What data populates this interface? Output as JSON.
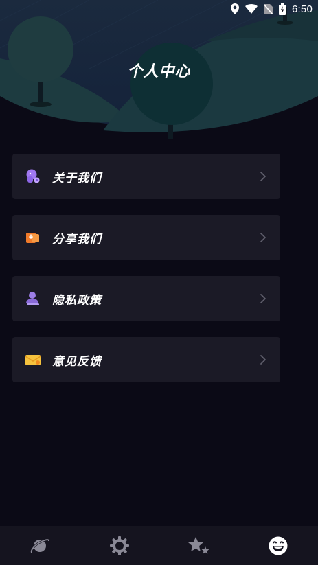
{
  "status_bar": {
    "time": "6:50",
    "icons": [
      "location-icon",
      "wifi-icon",
      "no-sim-icon",
      "battery-charging-icon"
    ]
  },
  "header": {
    "title": "个人中心"
  },
  "menu": [
    {
      "label": "关于我们",
      "icon": "about-us-icon",
      "color": "#a078f0"
    },
    {
      "label": "分享我们",
      "icon": "share-icon",
      "color": "#f07a2a"
    },
    {
      "label": "隐私政策",
      "icon": "privacy-icon",
      "color": "#9c7ee6"
    },
    {
      "label": "意见反馈",
      "icon": "feedback-icon",
      "color": "#f5c23e"
    }
  ],
  "bottom_nav": [
    {
      "icon": "planet-icon",
      "active": false
    },
    {
      "icon": "settings-icon",
      "active": false
    },
    {
      "icon": "stars-icon",
      "active": false
    },
    {
      "icon": "smile-icon",
      "active": true
    }
  ],
  "colors": {
    "background": "#0b0a16",
    "card": "#1b1a26",
    "nav": "#15141f",
    "nav_inactive": "#8a8996",
    "nav_active": "#ffffff"
  }
}
